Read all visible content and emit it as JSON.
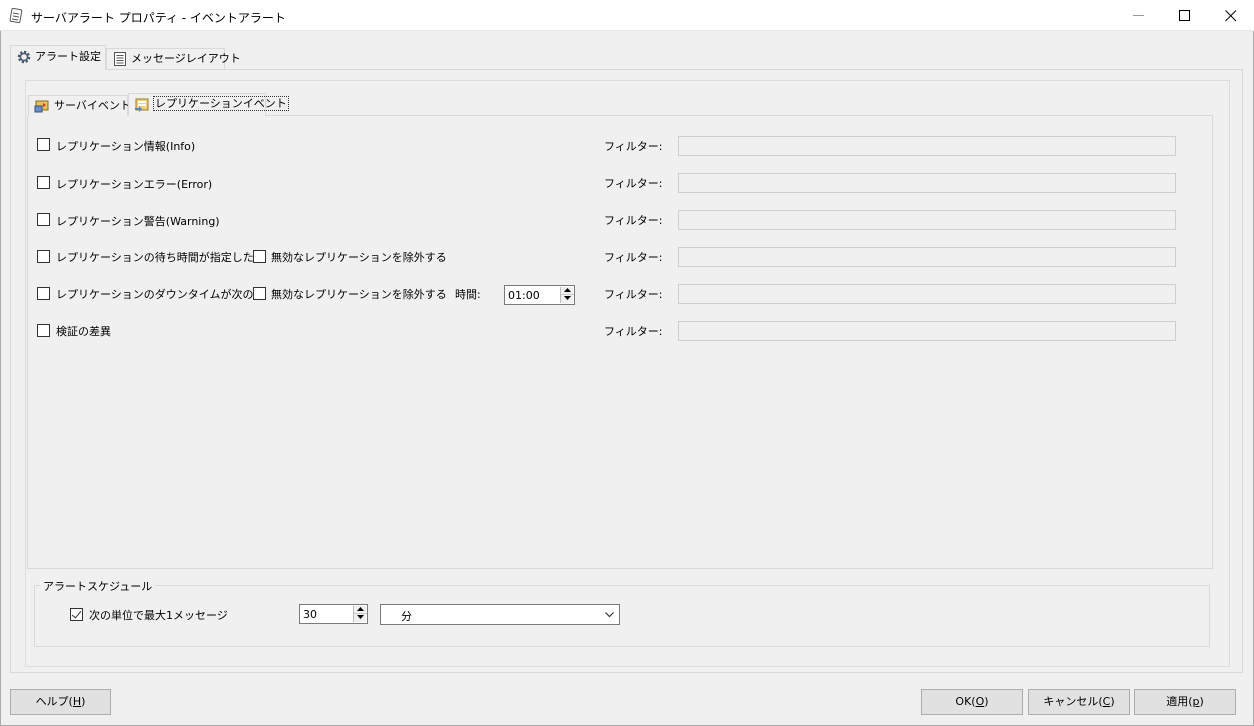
{
  "window": {
    "title": "サーバアラート プロパティ - イベントアラート",
    "icon": "notepad-icon"
  },
  "outer_tabs": [
    {
      "label": "アラート設定",
      "icon": "gear-icon",
      "active": true
    },
    {
      "label": "メッセージレイアウト",
      "icon": "document-icon",
      "active": false
    }
  ],
  "inner_tabs": [
    {
      "label": "サーバイベント",
      "icon": "server-event-icon",
      "active": false
    },
    {
      "label": "レプリケーションイベント",
      "icon": "replication-event-icon",
      "active": true
    }
  ],
  "events": [
    {
      "label": "レプリケーション情報(Info)",
      "checked": false,
      "filter_label": "フィルター:",
      "filter_value": ""
    },
    {
      "label": "レプリケーションエラー(Error)",
      "checked": false,
      "filter_label": "フィルター:",
      "filter_value": ""
    },
    {
      "label": "レプリケーション警告(Warning)",
      "checked": false,
      "filter_label": "フィルター:",
      "filter_value": ""
    },
    {
      "label": "レプリケーションの待ち時間が指定した",
      "checked": false,
      "exclude_label": "無効なレプリケーションを除外する",
      "exclude_checked": false,
      "filter_label": "フィルター:",
      "filter_value": ""
    },
    {
      "label": "レプリケーションのダウンタイムが次の値",
      "checked": false,
      "exclude_label": "無効なレプリケーションを除外する",
      "exclude_checked": false,
      "time_label": "時間:",
      "time_value": "01:00",
      "filter_label": "フィルター:",
      "filter_value": ""
    },
    {
      "label": "検証の差異",
      "checked": false,
      "filter_label": "フィルター:",
      "filter_value": ""
    }
  ],
  "schedule": {
    "group_title": "アラートスケジュール",
    "max_label": "次の単位で最大1メッセージ",
    "checked": true,
    "count_value": "30",
    "unit_value": "分"
  },
  "buttons": {
    "help": {
      "text": "ヘルプ(",
      "key": "H",
      "close": ")"
    },
    "ok": {
      "text": "OK(",
      "key": "O",
      "close": ")"
    },
    "cancel": {
      "text": "キャンセル(",
      "key": "C",
      "close": ")"
    },
    "apply": {
      "text": "適用(",
      "key": "p",
      "close": ")"
    }
  }
}
